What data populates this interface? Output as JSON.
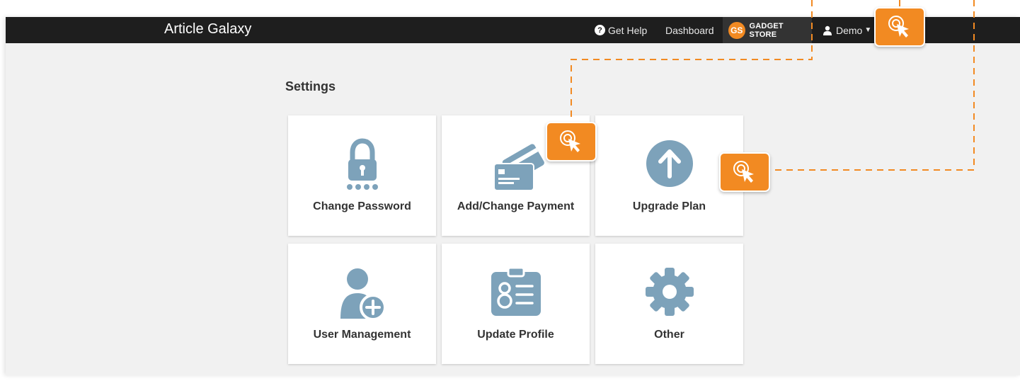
{
  "header": {
    "brand": "Article Galaxy",
    "help_label": "Get Help",
    "dashboard_label": "Dashboard",
    "store_initials": "GS",
    "store_name": "GADGET STORE",
    "user_label": "Demo"
  },
  "page": {
    "title": "Settings"
  },
  "cards": [
    {
      "label": "Change Password",
      "icon": "padlock-icon"
    },
    {
      "label": "Add/Change Payment",
      "icon": "credit-card-icon"
    },
    {
      "label": "Upgrade Plan",
      "icon": "arrow-up-circle-icon"
    },
    {
      "label": "User Management",
      "icon": "add-user-icon"
    },
    {
      "label": "Update Profile",
      "icon": "id-badge-icon"
    },
    {
      "label": "Other",
      "icon": "gear-icon"
    }
  ],
  "colors": {
    "accent": "#f28a22",
    "icon": "#7da2ba",
    "topbar": "#1e1e1e",
    "background": "#f1f1f1"
  }
}
